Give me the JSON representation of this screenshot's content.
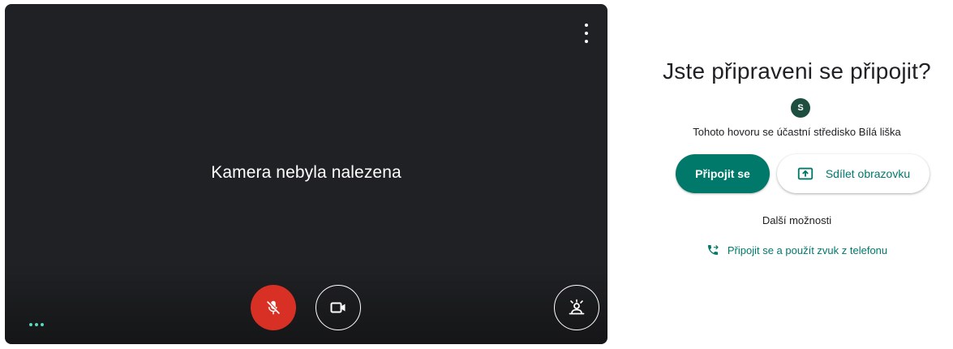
{
  "preview": {
    "message": "Kamera nebyla nalezena",
    "more_options_icon": "more-vert-icon",
    "status_dots_icon": "connection-dots-icon",
    "mic_button": {
      "icon": "mic-off-icon",
      "state": "muted",
      "color": "#d93025"
    },
    "camera_button": {
      "icon": "videocam-icon"
    },
    "effects_button": {
      "icon": "visual-effects-icon"
    }
  },
  "join": {
    "title": "Jste připraveni se připojit?",
    "avatar_initial": "S",
    "avatar_color": "#1e4e40",
    "participants_text": "Tohoto hovoru se účastní středisko Bílá liška",
    "join_button_label": "Připojit se",
    "present_button_label": "Sdílet obrazovku",
    "more_options_label": "Další možnosti",
    "phone_audio_label": "Připojit se a použít zvuk z telefonu",
    "accent_color": "#00796b"
  }
}
